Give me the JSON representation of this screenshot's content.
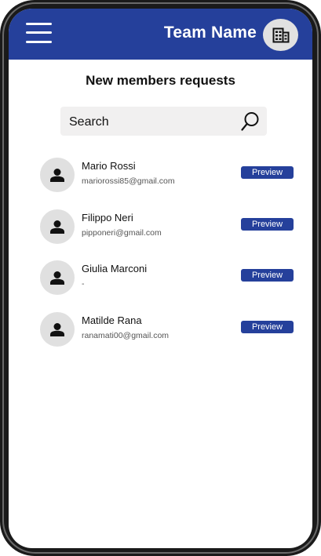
{
  "header": {
    "team_name": "Team Name",
    "menu_icon": "hamburger-menu-icon",
    "team_icon": "building-icon"
  },
  "page": {
    "title": "New members requests"
  },
  "search": {
    "placeholder": "Search",
    "icon": "search-icon"
  },
  "requests": [
    {
      "name": "Mario Rossi",
      "email": "mariorossi85@gmail.com",
      "preview_label": "Preview"
    },
    {
      "name": "Filippo Neri",
      "email": "pipponeri@gmail.com",
      "preview_label": "Preview"
    },
    {
      "name": "Giulia Marconi",
      "email": "-",
      "preview_label": "Preview"
    },
    {
      "name": "Matilde Rana",
      "email": "ranamati00@gmail.com",
      "preview_label": "Preview"
    }
  ],
  "colors": {
    "primary": "#25409b",
    "avatar_bg": "#e0e0e0",
    "search_bg": "#f1f0f0"
  }
}
